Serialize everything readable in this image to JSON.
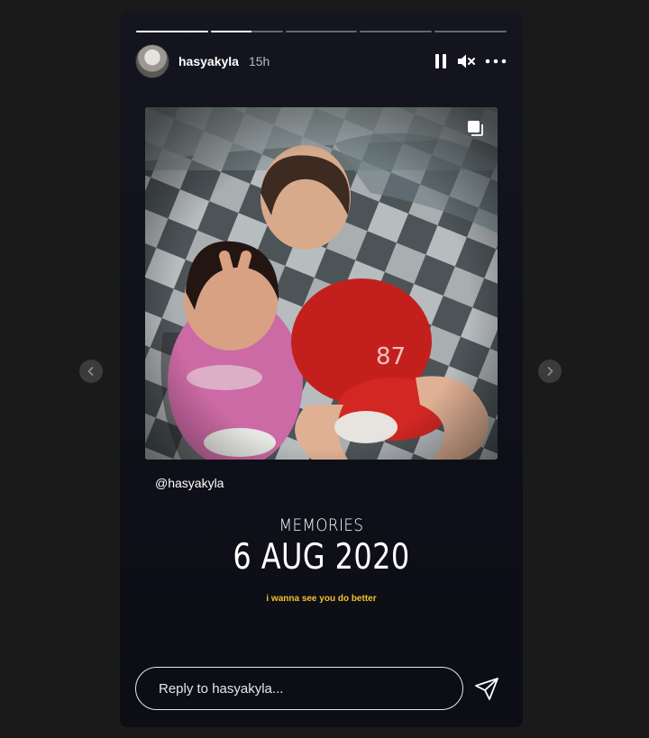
{
  "story": {
    "progress": [
      1,
      0.57,
      0,
      0,
      0
    ],
    "user": {
      "username": "hasyakyla",
      "time_ago": "15h"
    },
    "controls": [
      "pause-icon",
      "muted-speaker-icon",
      "more-options-icon"
    ],
    "mention": "@hasyakyla",
    "memories": {
      "title": "MEMORIES",
      "date": "6 AUG 2020"
    },
    "caption": "i wanna see you do better",
    "caption_color": "#f2c12e",
    "reply": {
      "placeholder": "Reply to hasyakyla...",
      "value": ""
    }
  },
  "navigation": {
    "prev_icon": "chevron-left-icon",
    "next_icon": "chevron-right-icon"
  }
}
